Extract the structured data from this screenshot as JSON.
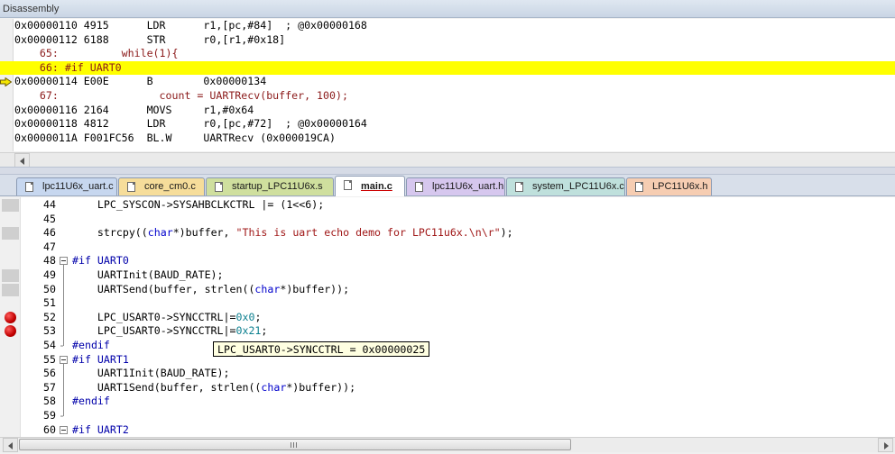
{
  "disassembly": {
    "title": "Disassembly",
    "lines": [
      {
        "text": "0x00000110 4915      LDR      r1,[pc,#84]  ; @0x00000168",
        "kind": "asm"
      },
      {
        "text": "0x00000112 6188      STR      r0,[r1,#0x18]",
        "kind": "asm"
      },
      {
        "text": "    65:          while(1){",
        "kind": "src"
      },
      {
        "text": "    66: #if UART0",
        "kind": "src-current"
      },
      {
        "text": "0x00000114 E00E      B        0x00000134",
        "kind": "asm-current"
      },
      {
        "text": "    67:                count = UARTRecv(buffer, 100);",
        "kind": "src"
      },
      {
        "text": "0x00000116 2164      MOVS     r1,#0x64",
        "kind": "asm"
      },
      {
        "text": "0x00000118 4812      LDR      r0,[pc,#72]  ; @0x00000164",
        "kind": "asm"
      },
      {
        "text": "0x0000011A F001FC56  BL.W     UARTRecv (0x000019CA)",
        "kind": "asm"
      }
    ]
  },
  "tabs": [
    {
      "label": "lpc11U6x_uart.c",
      "color": "#c7d7ef",
      "active": false
    },
    {
      "label": "core_cm0.c",
      "color": "#f6dd9a",
      "active": false
    },
    {
      "label": "startup_LPC11U6x.s",
      "color": "#cfdf9e",
      "active": false
    },
    {
      "label": "main.c",
      "color": "#f3c2c2",
      "active": true
    },
    {
      "label": "lpc11U6x_uart.h",
      "color": "#d6c7ee",
      "active": false
    },
    {
      "label": "system_LPC11U6x.c",
      "color": "#bfe0dc",
      "active": false
    },
    {
      "label": "LPC11U6x.h",
      "color": "#f6cdb2",
      "active": false
    }
  ],
  "editor": {
    "lines": [
      {
        "num": "44",
        "text": "    LPC_SYSCON->SYSAHBCLKCTRL |= (1<<6);",
        "marker": "exec"
      },
      {
        "num": "45",
        "text": "",
        "marker": ""
      },
      {
        "num": "46",
        "text": "    strcpy((char*)buffer, \"This is uart echo demo for LPC11u6x.\\n\\r\");",
        "marker": "exec"
      },
      {
        "num": "47",
        "text": "",
        "marker": ""
      },
      {
        "num": "48",
        "text": "#if UART0",
        "marker": "",
        "fold": true
      },
      {
        "num": "49",
        "text": "    UARTInit(BAUD_RATE);",
        "marker": "exec"
      },
      {
        "num": "50",
        "text": "    UARTSend(buffer, strlen((char*)buffer));",
        "marker": "exec"
      },
      {
        "num": "51",
        "text": "",
        "marker": ""
      },
      {
        "num": "52",
        "text": "    LPC_USART0->SYNCCTRL|=0x0;",
        "marker": "breakpoint"
      },
      {
        "num": "53",
        "text": "    LPC_USART0->SYNCCTRL|=0x21;",
        "marker": "breakpoint"
      },
      {
        "num": "54",
        "text": "#endif",
        "marker": "",
        "dash": true
      },
      {
        "num": "55",
        "text": "#if UART1",
        "marker": "",
        "fold": true
      },
      {
        "num": "56",
        "text": "    UART1Init(BAUD_RATE);",
        "marker": ""
      },
      {
        "num": "57",
        "text": "    UART1Send(buffer, strlen((char*)buffer));",
        "marker": ""
      },
      {
        "num": "58",
        "text": "#endif",
        "marker": ""
      },
      {
        "num": "59",
        "text": "",
        "marker": "",
        "dash": true
      },
      {
        "num": "60",
        "text": "#if UART2",
        "marker": "",
        "fold": true
      }
    ],
    "tooltip": "LPC_USART0->SYNCCTRL = 0x00000025"
  },
  "colors": {
    "current_line": "#ffff00",
    "breakpoint": "#cc0000",
    "string": "#a01818",
    "keyword": "#0000cc"
  }
}
